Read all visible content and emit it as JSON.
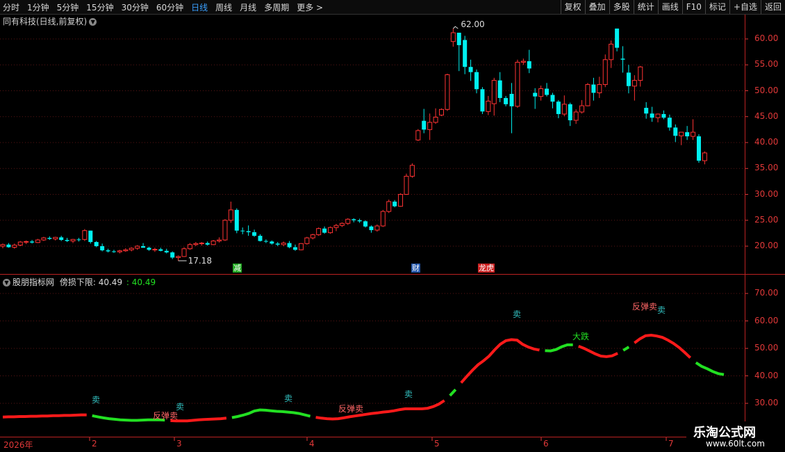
{
  "toolbar": {
    "periods": [
      {
        "label": "分时",
        "active": false
      },
      {
        "label": "1分钟",
        "active": false
      },
      {
        "label": "5分钟",
        "active": false
      },
      {
        "label": "15分钟",
        "active": false
      },
      {
        "label": "30分钟",
        "active": false
      },
      {
        "label": "60分钟",
        "active": false
      },
      {
        "label": "日线",
        "active": true
      },
      {
        "label": "周线",
        "active": false
      },
      {
        "label": "月线",
        "active": false
      },
      {
        "label": "多周期",
        "active": false
      },
      {
        "label": "更多 >",
        "active": false
      }
    ],
    "tools": [
      "复权",
      "叠加",
      "多股",
      "统计",
      "画线",
      "F10",
      "标记",
      "+自选",
      "返回"
    ]
  },
  "chart_title": "同有科技(日线,前复权)",
  "indicator": {
    "name": "股朋指标网",
    "label": "傍损下限",
    "value1": "40.49",
    "value2": "40.49"
  },
  "colors": {
    "up": "#ff3333",
    "down": "#00f0f0",
    "axis": "#e03838",
    "line_red": "#ff1a1a",
    "line_green": "#22e022"
  },
  "watermark": {
    "title": "乐淘公式网",
    "url": "www.60lt.com"
  },
  "chart_data": [
    {
      "type": "candlestick",
      "title": "同有科技(日线,前复权)",
      "yticks": [
        "60.00",
        "55.00",
        "50.00",
        "45.00",
        "40.00",
        "35.00",
        "30.00",
        "25.00",
        "20.00"
      ],
      "ylim": [
        15,
        63
      ],
      "annotations": {
        "high": "62.00",
        "low": "17.18"
      },
      "event_markers": [
        "减",
        "财",
        "龙虎"
      ],
      "candles": [
        [
          20.0,
          20.5,
          19.6,
          20.3
        ],
        [
          20.3,
          20.6,
          19.7,
          19.8
        ],
        [
          19.8,
          20.5,
          19.5,
          20.2
        ],
        [
          20.2,
          21.0,
          20.0,
          20.8
        ],
        [
          20.8,
          21.1,
          20.4,
          20.9
        ],
        [
          20.9,
          21.2,
          20.5,
          20.7
        ],
        [
          20.7,
          21.4,
          20.6,
          21.2
        ],
        [
          21.2,
          21.8,
          21.0,
          21.6
        ],
        [
          21.6,
          21.9,
          21.2,
          21.4
        ],
        [
          21.4,
          21.8,
          21.1,
          21.7
        ],
        [
          21.7,
          22.0,
          21.0,
          21.2
        ],
        [
          21.2,
          21.6,
          20.8,
          21.0
        ],
        [
          21.0,
          21.4,
          20.6,
          21.3
        ],
        [
          21.3,
          21.6,
          20.9,
          21.2
        ],
        [
          21.3,
          23.3,
          21.0,
          23.0
        ],
        [
          23.0,
          23.0,
          20.5,
          20.8
        ],
        [
          20.8,
          21.0,
          19.8,
          20.0
        ],
        [
          20.0,
          20.5,
          19.0,
          19.2
        ],
        [
          19.2,
          19.5,
          18.8,
          19.0
        ],
        [
          19.0,
          19.3,
          18.7,
          18.9
        ],
        [
          18.9,
          19.3,
          18.6,
          19.1
        ],
        [
          19.1,
          19.6,
          18.9,
          19.3
        ],
        [
          19.3,
          19.8,
          19.0,
          19.6
        ],
        [
          19.6,
          20.2,
          19.3,
          20.0
        ],
        [
          20.0,
          20.6,
          19.7,
          19.7
        ],
        [
          19.7,
          19.9,
          19.1,
          19.3
        ],
        [
          19.3,
          19.7,
          18.9,
          19.4
        ],
        [
          19.4,
          19.7,
          19.0,
          19.1
        ],
        [
          19.1,
          19.5,
          18.6,
          18.8
        ],
        [
          18.8,
          19.0,
          17.5,
          17.8
        ],
        [
          17.8,
          18.2,
          17.18,
          18.0
        ],
        [
          18.0,
          19.8,
          17.9,
          19.5
        ],
        [
          19.5,
          20.6,
          19.3,
          20.3
        ],
        [
          20.3,
          20.8,
          20.0,
          20.5
        ],
        [
          20.5,
          20.8,
          20.1,
          20.6
        ],
        [
          20.6,
          20.9,
          20.1,
          20.3
        ],
        [
          20.3,
          21.2,
          20.2,
          21.0
        ],
        [
          21.0,
          21.7,
          20.7,
          21.2
        ],
        [
          21.2,
          25.2,
          21.0,
          25.0
        ],
        [
          25.0,
          28.6,
          24.5,
          27.0
        ],
        [
          27.0,
          27.3,
          22.5,
          23.0
        ],
        [
          23.0,
          23.6,
          22.3,
          22.9
        ],
        [
          22.9,
          24.0,
          22.0,
          22.7
        ],
        [
          22.7,
          23.2,
          21.8,
          22.0
        ],
        [
          22.0,
          22.3,
          20.9,
          21.0
        ],
        [
          21.0,
          21.3,
          20.6,
          20.9
        ],
        [
          20.9,
          21.1,
          20.3,
          20.5
        ],
        [
          20.5,
          20.8,
          20.0,
          20.3
        ],
        [
          20.3,
          20.9,
          20.0,
          20.6
        ],
        [
          20.6,
          21.0,
          19.6,
          19.8
        ],
        [
          19.8,
          20.3,
          19.1,
          19.3
        ],
        [
          19.3,
          20.6,
          19.2,
          20.5
        ],
        [
          20.5,
          21.8,
          20.3,
          21.6
        ],
        [
          21.6,
          22.4,
          21.3,
          22.2
        ],
        [
          22.2,
          23.6,
          22.0,
          23.4
        ],
        [
          23.4,
          23.8,
          22.4,
          22.6
        ],
        [
          22.6,
          23.8,
          22.4,
          23.6
        ],
        [
          23.6,
          24.3,
          22.9,
          24.0
        ],
        [
          24.0,
          24.6,
          23.7,
          24.4
        ],
        [
          24.4,
          25.4,
          24.1,
          25.2
        ],
        [
          25.2,
          25.4,
          24.6,
          25.0
        ],
        [
          25.0,
          25.3,
          24.5,
          24.8
        ],
        [
          24.8,
          25.0,
          23.6,
          23.8
        ],
        [
          23.8,
          24.0,
          22.6,
          23.1
        ],
        [
          23.1,
          24.2,
          22.8,
          23.9
        ],
        [
          23.9,
          27.0,
          23.7,
          26.7
        ],
        [
          26.7,
          29.0,
          26.4,
          28.6
        ],
        [
          28.6,
          28.9,
          27.5,
          27.7
        ],
        [
          27.7,
          30.2,
          27.6,
          30.0
        ],
        [
          30.0,
          34.0,
          29.9,
          33.5
        ],
        [
          33.5,
          36.0,
          33.2,
          35.6
        ],
        [
          40.5,
          42.6,
          40.3,
          42.3
        ],
        [
          44.2,
          46.5,
          41.8,
          42.5
        ],
        [
          42.5,
          45.6,
          40.5,
          43.9
        ],
        [
          43.9,
          46.6,
          43.6,
          44.9
        ],
        [
          45.3,
          46.6,
          45.1,
          46.4
        ],
        [
          46.4,
          53.3,
          46.1,
          53.1
        ],
        [
          59.5,
          62.0,
          58.5,
          61.2
        ],
        [
          61.2,
          61.2,
          53.8,
          58.8
        ],
        [
          59.8,
          60.6,
          53.2,
          54.6
        ],
        [
          54.6,
          56.0,
          51.9,
          53.6
        ],
        [
          53.6,
          54.1,
          49.5,
          50.3
        ],
        [
          50.3,
          50.7,
          45.5,
          46.0
        ],
        [
          46.0,
          49.0,
          45.3,
          48.0
        ],
        [
          47.5,
          52.5,
          45.2,
          52.0
        ],
        [
          52.0,
          53.6,
          47.8,
          48.6
        ],
        [
          48.6,
          49.0,
          47.0,
          47.4
        ],
        [
          49.4,
          51.5,
          41.8,
          47.0
        ],
        [
          47.0,
          56.0,
          46.7,
          55.5
        ],
        [
          55.5,
          56.2,
          55.0,
          55.7
        ],
        [
          55.7,
          57.9,
          53.4,
          54.3
        ],
        [
          49.6,
          50.5,
          46.5,
          48.9
        ],
        [
          48.9,
          51.0,
          48.1,
          50.4
        ],
        [
          50.4,
          51.5,
          48.9,
          49.2
        ],
        [
          49.2,
          49.6,
          46.6,
          47.9
        ],
        [
          47.9,
          48.2,
          44.7,
          45.5
        ],
        [
          45.5,
          49.1,
          45.1,
          47.4
        ],
        [
          47.4,
          47.7,
          43.2,
          44.3
        ],
        [
          44.3,
          46.4,
          43.6,
          45.9
        ],
        [
          45.9,
          48.2,
          45.6,
          47.1
        ],
        [
          47.1,
          51.5,
          47.0,
          51.2
        ],
        [
          51.2,
          52.5,
          48.1,
          49.6
        ],
        [
          49.6,
          52.7,
          48.6,
          51.2
        ],
        [
          51.2,
          57.0,
          50.7,
          56.0
        ],
        [
          56.0,
          59.7,
          54.4,
          59.0
        ],
        [
          62.0,
          62.0,
          57.6,
          58.3
        ],
        [
          56.2,
          58.6,
          53.5,
          56.0
        ],
        [
          53.5,
          55.0,
          49.5,
          50.9
        ],
        [
          50.9,
          53.0,
          48.1,
          52.0
        ],
        [
          52.0,
          54.8,
          50.8,
          54.6
        ],
        [
          46.7,
          47.8,
          44.6,
          45.6
        ],
        [
          45.6,
          46.9,
          44.0,
          44.8
        ],
        [
          44.8,
          45.6,
          43.9,
          45.5
        ],
        [
          45.5,
          46.2,
          44.5,
          44.8
        ],
        [
          44.8,
          45.4,
          42.3,
          42.9
        ],
        [
          42.9,
          43.5,
          40.1,
          41.3
        ],
        [
          41.3,
          42.0,
          39.5,
          42.0
        ],
        [
          42.0,
          43.2,
          40.5,
          41.2
        ],
        [
          41.2,
          44.5,
          40.5,
          42.0
        ],
        [
          41.2,
          41.6,
          36.1,
          36.5
        ],
        [
          36.5,
          38.3,
          35.8,
          38.0
        ]
      ]
    },
    {
      "type": "line",
      "title": "股朋指标网",
      "yticks": [
        "70.00",
        "60.00",
        "50.00",
        "40.00",
        "30.00"
      ],
      "ylim": [
        22,
        76
      ],
      "series": [
        {
          "name": "傍损下限",
          "values": [
            25.0,
            25.1,
            25.1,
            25.2,
            25.2,
            25.3,
            25.3,
            25.4,
            25.4,
            25.5,
            25.5,
            25.6,
            25.6,
            25.7,
            25.8,
            25.8,
            25.5,
            25.1,
            24.7,
            24.4,
            24.2,
            24.0,
            23.9,
            23.8,
            23.8,
            23.9,
            24.0,
            24.0,
            24.0,
            23.9,
            23.7,
            23.6,
            23.6,
            23.6,
            23.8,
            24.0,
            24.1,
            24.2,
            24.3,
            24.4,
            24.6,
            24.8,
            25.2,
            25.7,
            26.3,
            27.2,
            27.6,
            27.5,
            27.3,
            27.1,
            27.0,
            26.8,
            26.6,
            26.3,
            25.8,
            25.3,
            24.9,
            24.6,
            24.4,
            24.3,
            24.4,
            24.7,
            25.1,
            25.4,
            25.7,
            26.0,
            26.3,
            26.5,
            26.8,
            27.0,
            27.3,
            27.7,
            28.0,
            28.0,
            28.0,
            28.0,
            28.2,
            28.8,
            29.7,
            31.0,
            32.8,
            35.0,
            37.5,
            39.8,
            42.0,
            44.0,
            45.5,
            47.2,
            49.5,
            51.5,
            52.8,
            53.2,
            53.0,
            51.5,
            50.5,
            49.8,
            49.4,
            49.2,
            49.1,
            49.6,
            50.6,
            51.3,
            51.3,
            50.8,
            50.0,
            49.0,
            48.0,
            47.2,
            47.0,
            47.3,
            48.2,
            49.3,
            50.5,
            52.0,
            53.5,
            54.6,
            54.8,
            54.5,
            54.0,
            53.0,
            51.8,
            50.3,
            48.5,
            46.6,
            44.8,
            43.5,
            42.6,
            41.6,
            40.8,
            40.49
          ]
        }
      ],
      "signals": [
        "卖",
        "反弹卖",
        "卖",
        "卖",
        "反弹卖",
        "卖",
        "卖",
        "大跌",
        "反弹卖",
        "卖"
      ]
    }
  ],
  "xticks": [
    "2026年",
    "2",
    "3",
    "4",
    "5",
    "6",
    "7"
  ]
}
